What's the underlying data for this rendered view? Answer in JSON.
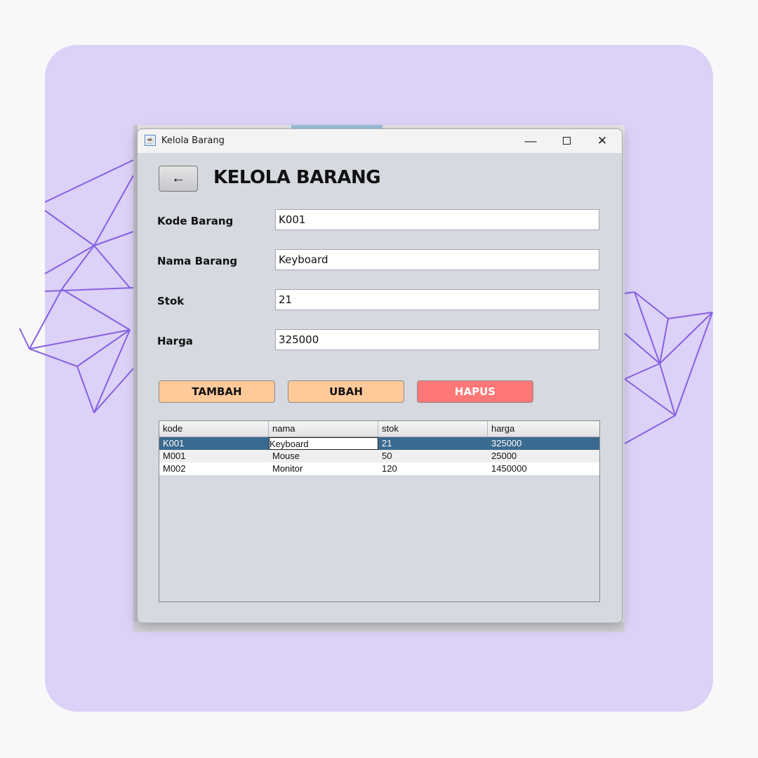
{
  "window": {
    "title": "Kelola Barang",
    "controls": {
      "minimize": "—",
      "maximize": "",
      "close": "✕"
    }
  },
  "header": {
    "back_icon": "←",
    "title": "KELOLA BARANG"
  },
  "form": {
    "kode": {
      "label": "Kode Barang",
      "value": "K001"
    },
    "nama": {
      "label": "Nama Barang",
      "value": "Keyboard"
    },
    "stok": {
      "label": "Stok",
      "value": "21"
    },
    "harga": {
      "label": "Harga",
      "value": "325000"
    }
  },
  "buttons": {
    "tambah": "TAMBAH",
    "ubah": "UBAH",
    "hapus": "HAPUS"
  },
  "table": {
    "columns": [
      "kode",
      "nama",
      "stok",
      "harga"
    ],
    "rows": [
      [
        "K001",
        "Keyboard",
        "21",
        "325000"
      ],
      [
        "M001",
        "Mouse",
        "50",
        "25000"
      ],
      [
        "M002",
        "Monitor",
        "120",
        "1450000"
      ]
    ],
    "selected_row": 0
  },
  "colors": {
    "accent_orange": "#ffc999",
    "accent_red": "#ff7777",
    "selection": "#3a6a8f",
    "background_card": "#dcd1f6"
  }
}
